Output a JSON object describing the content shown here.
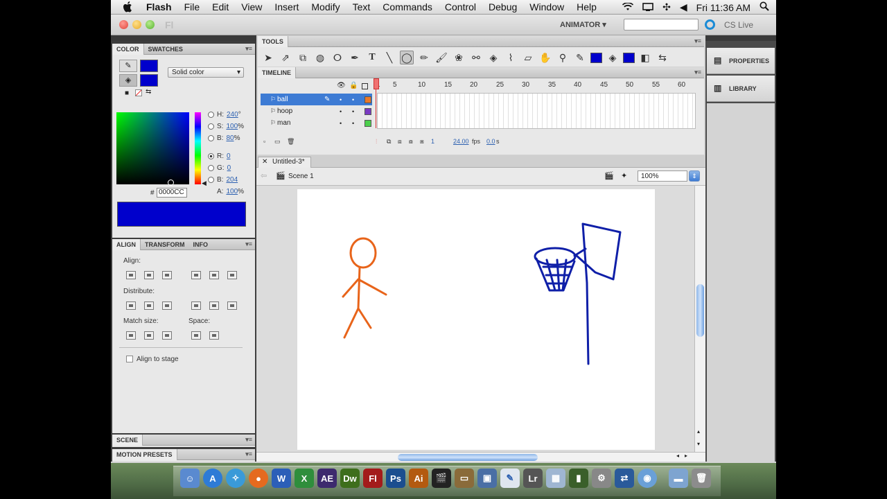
{
  "menubar": {
    "app": "Flash",
    "items": [
      "File",
      "Edit",
      "View",
      "Insert",
      "Modify",
      "Text",
      "Commands",
      "Control",
      "Debug",
      "Window",
      "Help"
    ],
    "clock": "Fri 11:36 AM"
  },
  "appbar": {
    "ghost_logo": "Fl",
    "workspace": "ANIMATOR ▾",
    "search_placeholder": "",
    "cs_live": "CS Live"
  },
  "color_panel": {
    "tabs": [
      "COLOR",
      "SWATCHES"
    ],
    "fill_type": "Solid color",
    "h": "240",
    "h_unit": "°",
    "s": "100",
    "s_unit": "%",
    "b": "80",
    "b_unit": "%",
    "r": "0",
    "g": "0",
    "bl": "204",
    "a": "100",
    "a_unit": "%",
    "h_label": "H:",
    "s_label": "S:",
    "b_label": "B:",
    "r_label": "R:",
    "g_label": "G:",
    "bl_label": "B:",
    "a_label": "A:",
    "hash": "#",
    "hex": "0000CC",
    "color": "#0000CC"
  },
  "align_panel": {
    "tabs": [
      "ALIGN",
      "TRANSFORM",
      "INFO"
    ],
    "align": "Align:",
    "distribute": "Distribute:",
    "match_size": "Match size:",
    "space": "Space:",
    "align_to_stage": "Align to stage"
  },
  "scene_panel": {
    "title": "SCENE"
  },
  "motion_presets": {
    "title": "MOTION PRESETS"
  },
  "tools": {
    "title": "TOOLS"
  },
  "timeline": {
    "title": "TIMELINE",
    "layers": [
      {
        "name": "ball",
        "color": "#e8782a"
      },
      {
        "name": "hoop",
        "color": "#7a3ac2"
      },
      {
        "name": "man",
        "color": "#4ccf4c"
      }
    ],
    "ruler": [
      "1",
      "5",
      "10",
      "15",
      "20",
      "25",
      "30",
      "35",
      "40",
      "45",
      "50",
      "55",
      "60"
    ],
    "current_frame": "1",
    "fps": "24.00",
    "fps_unit": "fps",
    "time": "0.0",
    "time_unit": "s"
  },
  "document": {
    "tab": "Untitled-3*",
    "scene": "Scene 1",
    "zoom": "100%"
  },
  "right_panels": {
    "properties": "PROPERTIES",
    "library": "LIBRARY"
  },
  "dock": {
    "apps": [
      "AE",
      "Dw",
      "Fl",
      "Ps",
      "Ai",
      "Lr"
    ]
  }
}
